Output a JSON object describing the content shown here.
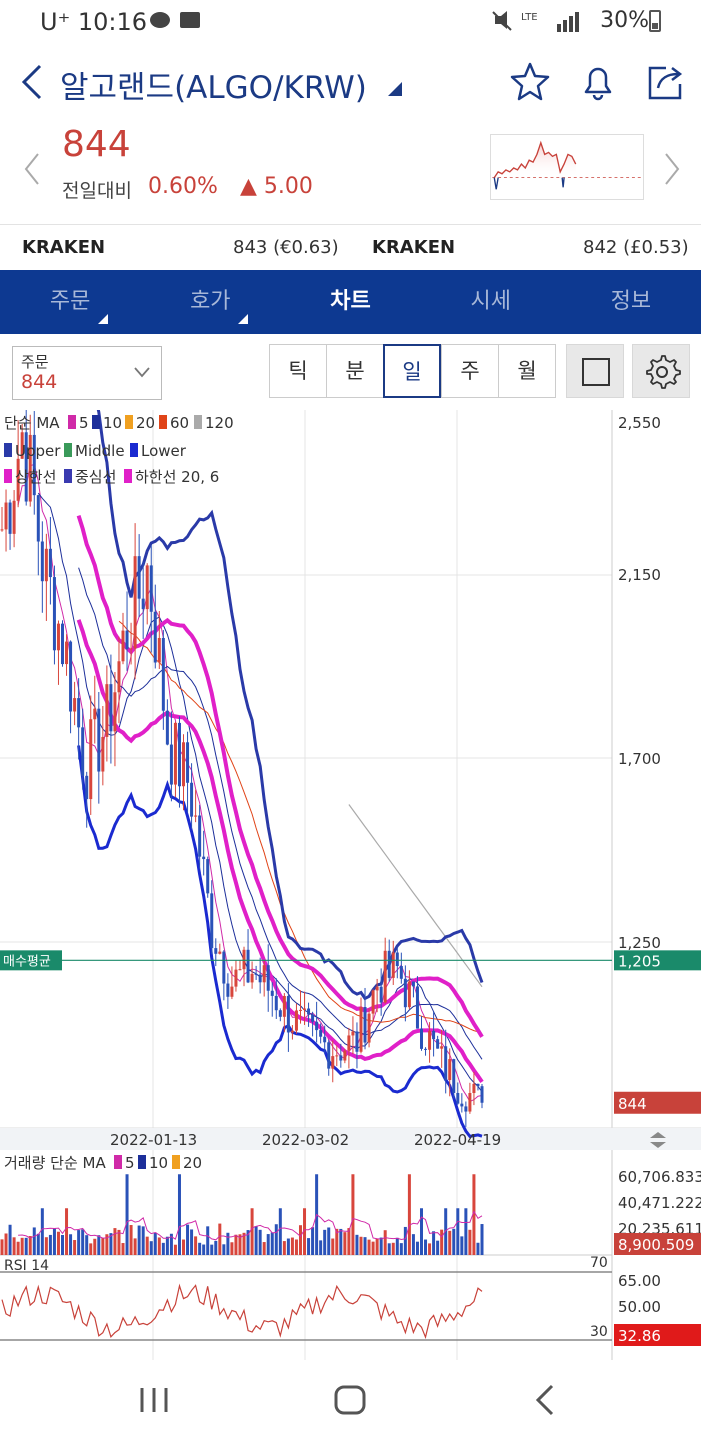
{
  "status": {
    "carrier": "U⁺",
    "time": "10:16",
    "battery": "30%",
    "network": "LTE"
  },
  "header": {
    "title": "알고랜드(ALGO/KRW)"
  },
  "price": {
    "current": "844",
    "change_label": "전일대비",
    "change_pct": "0.60%",
    "change_val": "▲ 5.00"
  },
  "exchanges": [
    {
      "name": "KRAKEN",
      "value": "843 (€0.63)"
    },
    {
      "name": "KRAKEN",
      "value": "842 (£0.53)"
    }
  ],
  "tabs": [
    {
      "label": "주문",
      "has_menu": true
    },
    {
      "label": "호가",
      "has_menu": true
    },
    {
      "label": "차트",
      "active": true
    },
    {
      "label": "시세"
    },
    {
      "label": "정보"
    }
  ],
  "toolbar": {
    "order_label": "주문",
    "order_value": "844",
    "periods": [
      "틱",
      "분",
      "일",
      "주",
      "월"
    ],
    "active_period": "일"
  },
  "colors": {
    "brand": "#0d3991",
    "up": "#c8423a",
    "down": "#1b3a84",
    "avg_line": "#1a8a6a",
    "bb_line": "#2a3aa8",
    "env_line": "#e040d0"
  },
  "chart_data": {
    "type": "candlestick",
    "legend_ma": {
      "label": "단순 MA",
      "periods": [
        "5",
        "10",
        "20",
        "60",
        "120"
      ],
      "colors": [
        "#d02aa8",
        "#1d2f9a",
        "#f0a020",
        "#e04418",
        "#aaaaaa"
      ]
    },
    "legend_bb": [
      "Upper",
      "Middle",
      "Lower"
    ],
    "legend_env": [
      "상한선",
      "중심선",
      "하한선 20, 6"
    ],
    "price_axis": [
      "2,550",
      "2,150",
      "1,700",
      "1,250"
    ],
    "price_range": [
      780,
      2600
    ],
    "avg_label": "매수평균",
    "avg_value": "1,205",
    "avg_price": 1205,
    "last_value": "844",
    "last_price": 844,
    "x_labels": [
      "2022-01-13",
      "2022-03-02",
      "2022-04-19"
    ],
    "close_approx": [
      2300,
      2550,
      2200,
      2000,
      1700,
      1800,
      2050,
      2200,
      1750,
      1650,
      1300,
      1150,
      1180,
      1120,
      1050,
      1000,
      980,
      1000,
      1150,
      1180,
      1050,
      950,
      880,
      844
    ],
    "volume": {
      "label": "거래량 단순 MA",
      "periods": [
        "5",
        "10",
        "20"
      ],
      "axis": [
        "60,706.833",
        "40,471.222",
        "20,235.611"
      ],
      "last": "8,900.509"
    },
    "rsi": {
      "label": "RSI 14",
      "levels": [
        "70",
        "30"
      ],
      "axis": [
        "65.00",
        "50.00"
      ],
      "last": "32.86"
    }
  }
}
